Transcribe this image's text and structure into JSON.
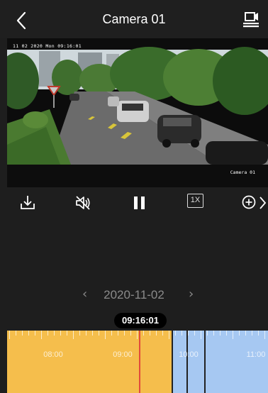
{
  "header": {
    "title": "Camera 01",
    "back_icon": "chevron-left-icon",
    "screen_icon": "playback-screen-icon"
  },
  "video": {
    "osd_timestamp": "11 02 2020 Mon 09:16:01",
    "osd_channel": "Camera 01"
  },
  "controls": {
    "download_icon": "download-icon",
    "mute_icon": "speaker-muted-icon",
    "pause_icon": "pause-icon",
    "speed_label": "1X",
    "zoom_icon": "zoom-in-icon",
    "more_icon": "chevron-right-icon"
  },
  "date_nav": {
    "prev": "‹",
    "date": "2020-11-02",
    "next": "›"
  },
  "current_time": "09:16:01",
  "timeline": {
    "labels": [
      "08:00",
      "09:00",
      "10:00",
      "11:00"
    ],
    "colors": {
      "event_recording": "#f5be4c",
      "continuous_recording": "#a6c8f2",
      "cursor": "#e24b3b",
      "segment_marker": "#222222"
    }
  }
}
